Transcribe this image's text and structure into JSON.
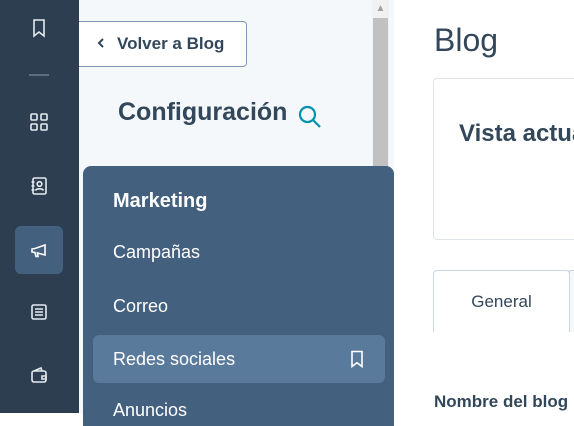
{
  "rail": {
    "icons": [
      "bookmark-icon",
      "apps-grid-icon",
      "contacts-icon",
      "megaphone-icon",
      "content-icon",
      "wallet-icon"
    ]
  },
  "settings": {
    "back_label": "Volver a Blog",
    "title": "Configuración"
  },
  "menu": {
    "heading": "Marketing",
    "items": [
      {
        "label": "Campañas"
      },
      {
        "label": "Correo"
      },
      {
        "label": "Redes sociales"
      },
      {
        "label": "Anuncios"
      }
    ]
  },
  "main": {
    "title": "Blog",
    "card_title": "Vista actual",
    "tabs": [
      {
        "label": "General"
      }
    ],
    "field_label": "Nombre del blog"
  },
  "colors": {
    "rail_bg": "#2d3e50",
    "menu_bg": "#44607f",
    "accent": "#0091ae"
  }
}
